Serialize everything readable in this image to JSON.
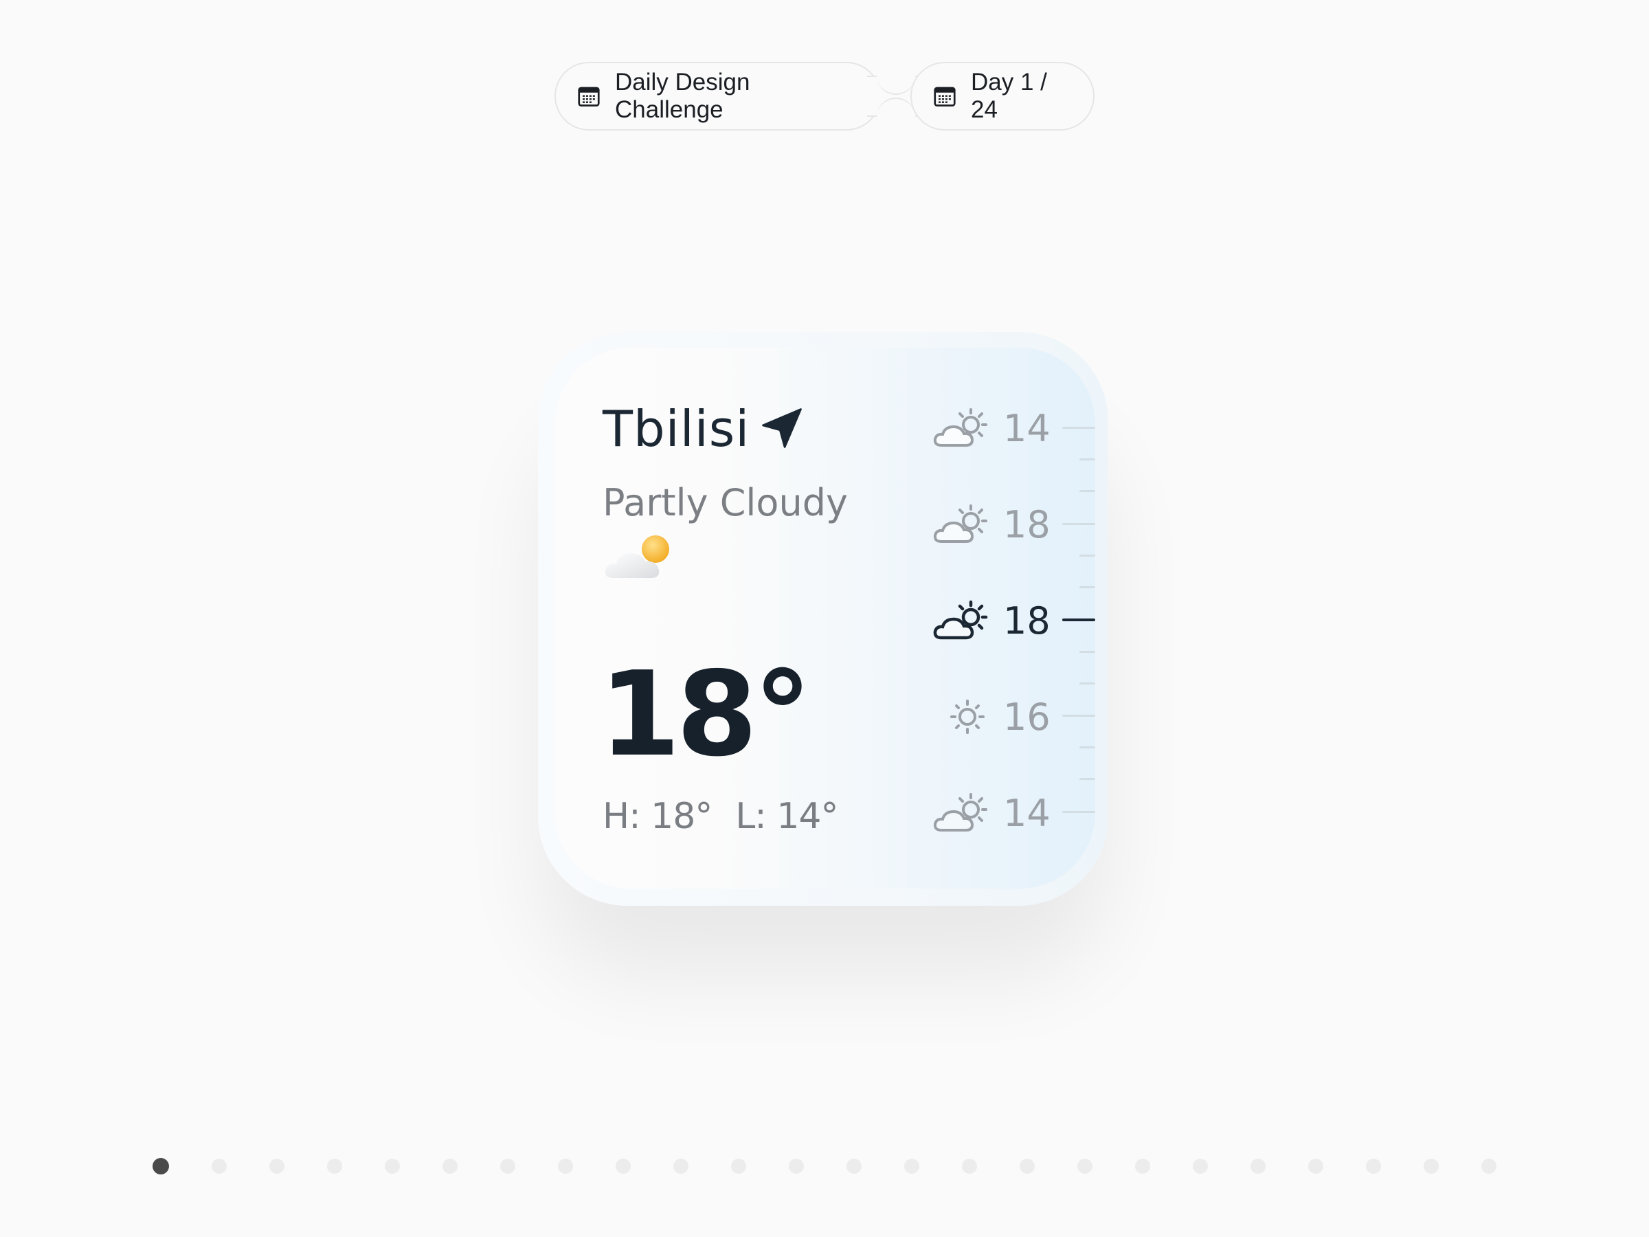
{
  "header": {
    "challenge_label": "Daily Design Challenge",
    "day_label": "Day 1 / 24"
  },
  "widget": {
    "city": "Tbilisi",
    "condition": "Partly Cloudy",
    "temperature": "18°",
    "high": "H: 18°",
    "low": "L: 14°",
    "hourly": [
      {
        "icon": "partly-cloudy-icon",
        "temp": "14",
        "active": false
      },
      {
        "icon": "partly-cloudy-icon",
        "temp": "18",
        "active": false
      },
      {
        "icon": "partly-cloudy-icon",
        "temp": "18",
        "active": true
      },
      {
        "icon": "sun-icon",
        "temp": "16",
        "active": false
      },
      {
        "icon": "partly-cloudy-icon",
        "temp": "14",
        "active": false
      }
    ]
  },
  "pagination": {
    "total": 24,
    "current": 1
  },
  "colors": {
    "text_dark": "#1b2733",
    "text_muted": "#9aa0a5",
    "accent_sun": "#f7b733",
    "widget_gradient_end": "#e3f1fb"
  }
}
